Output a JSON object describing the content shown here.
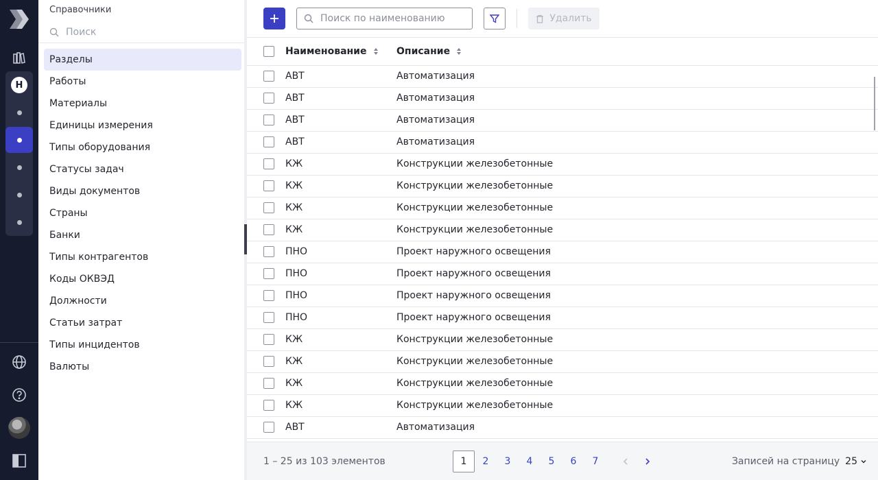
{
  "rail": {
    "logo_icon": "app-logo-icon",
    "workspace_letter": "Н",
    "active_color": "#3b3fc4",
    "bg_color": "#161b2e"
  },
  "directory": {
    "title": "Справочники",
    "search_placeholder": "Поиск",
    "items": [
      {
        "label": "Разделы",
        "active": true
      },
      {
        "label": "Работы"
      },
      {
        "label": "Материалы"
      },
      {
        "label": "Единицы измерения"
      },
      {
        "label": "Типы оборудования"
      },
      {
        "label": "Статусы задач"
      },
      {
        "label": "Виды документов"
      },
      {
        "label": "Страны"
      },
      {
        "label": "Банки"
      },
      {
        "label": "Типы контрагентов"
      },
      {
        "label": "Коды ОКВЭД"
      },
      {
        "label": "Должности"
      },
      {
        "label": "Статьи затрат"
      },
      {
        "label": "Типы инцидентов"
      },
      {
        "label": "Валюты"
      }
    ]
  },
  "toolbar": {
    "search_placeholder": "Поиск по наименованию",
    "delete_label": "Удалить"
  },
  "table": {
    "columns": [
      "Наименование",
      "Описание"
    ],
    "rows": [
      {
        "name": "АВТ",
        "desc": "Автоматизация"
      },
      {
        "name": "АВТ",
        "desc": "Автоматизация"
      },
      {
        "name": "АВТ",
        "desc": "Автоматизация"
      },
      {
        "name": "АВТ",
        "desc": "Автоматизация"
      },
      {
        "name": "КЖ",
        "desc": "Конструкции железобетонные"
      },
      {
        "name": "КЖ",
        "desc": "Конструкции железобетонные"
      },
      {
        "name": "КЖ",
        "desc": "Конструкции железобетонные"
      },
      {
        "name": "КЖ",
        "desc": "Конструкции железобетонные"
      },
      {
        "name": "ПНО",
        "desc": "Проект наружного освещения"
      },
      {
        "name": "ПНО",
        "desc": "Проект наружного освещения"
      },
      {
        "name": "ПНО",
        "desc": "Проект наружного освещения"
      },
      {
        "name": "ПНО",
        "desc": "Проект наружного освещения"
      },
      {
        "name": "КЖ",
        "desc": "Конструкции железобетонные"
      },
      {
        "name": "КЖ",
        "desc": "Конструкции железобетонные"
      },
      {
        "name": "КЖ",
        "desc": "Конструкции железобетонные"
      },
      {
        "name": "КЖ",
        "desc": "Конструкции железобетонные"
      },
      {
        "name": "АВТ",
        "desc": "Автоматизация"
      }
    ]
  },
  "footer": {
    "range_text": "1 – 25 из 103 элементов",
    "pages": [
      "1",
      "2",
      "3",
      "4",
      "5",
      "6",
      "7"
    ],
    "current_page": "1",
    "per_page_label": "Записей на страницу",
    "per_page_value": "25"
  }
}
